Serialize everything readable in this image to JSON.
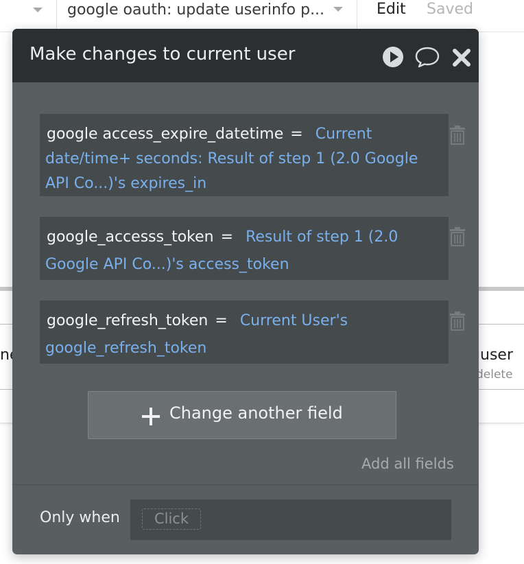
{
  "toolbar": {
    "workflow_select": "google oauth: update userinfo p...",
    "edit_label": "Edit",
    "saved_label": "Saved"
  },
  "background": {
    "left_card_text": "ne",
    "right_card_text": "user",
    "right_card_sub": "delete"
  },
  "popup": {
    "title": "Make changes to current user",
    "icons": [
      "play-icon",
      "comment-icon",
      "close-icon"
    ],
    "fields": [
      {
        "name": "google access_expire_datetime",
        "eq": "=",
        "value": "Current date/time+ seconds: Result of step 1 (2.0 Google API Co...)'s expires_in"
      },
      {
        "name": "google_accesss_token",
        "eq": "=",
        "value": "Result of step 1 (2.0 Google API Co...)'s access_token"
      },
      {
        "name": "google_refresh_token",
        "eq": "=",
        "value": "Current User's google_refresh_token"
      }
    ],
    "change_another_label": "Change another field",
    "add_all_label": "Add all fields",
    "only_when_label": "Only when",
    "condition_placeholder": "Click"
  },
  "colors": {
    "popup_bg": "#595e60",
    "header_bg": "#2b2f31",
    "field_bg": "#454a4d",
    "expression_blue": "#79b0ec"
  }
}
